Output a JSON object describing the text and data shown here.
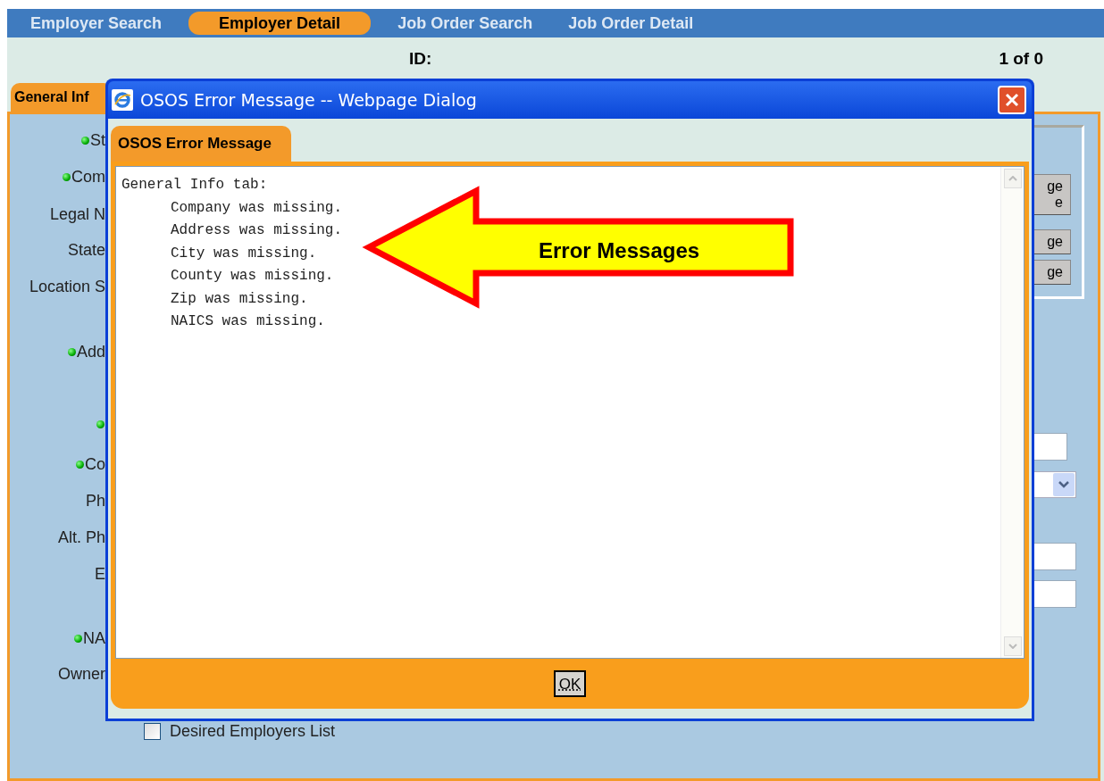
{
  "nav_tabs": [
    {
      "label": "Employer Search",
      "selected": false
    },
    {
      "label": "Employer Detail",
      "selected": true
    },
    {
      "label": "Job Order Search",
      "selected": false
    },
    {
      "label": "Job Order Detail",
      "selected": false
    }
  ],
  "header": {
    "id_label": "ID:",
    "record_count": "1 of 0"
  },
  "page_tab": {
    "label": "General Inf",
    "selected": true
  },
  "form_labels": [
    {
      "label": "St",
      "required": true
    },
    {
      "label": "Com",
      "required": true
    },
    {
      "label": "Legal N",
      "required": false
    },
    {
      "label": "State",
      "required": false
    },
    {
      "label": "Location S",
      "required": false
    },
    {
      "label": "Add",
      "required": true
    },
    {
      "required": true
    },
    {
      "label": "Co",
      "required": true
    },
    {
      "label": "Ph",
      "required": false
    },
    {
      "label": "Alt. Ph",
      "required": false
    },
    {
      "label": "E",
      "required": false
    },
    {
      "label": "NA",
      "required": true
    },
    {
      "label": "Owner",
      "required": false
    }
  ],
  "right_buttons": [
    {
      "lines": [
        "ge",
        "e"
      ]
    },
    {
      "lines": [
        "ge"
      ]
    },
    {
      "lines": [
        "ge"
      ]
    }
  ],
  "right_fields": [
    {
      "kind": "input"
    },
    {
      "kind": "select"
    },
    {
      "kind": "input"
    },
    {
      "kind": "input"
    }
  ],
  "checkbox": {
    "label": "Desired Employers List",
    "checked": false
  },
  "dialog": {
    "title": "OSOS Error Message -- Webpage Dialog",
    "tab": "OSOS Error Message",
    "message_heading": "General Info tab:",
    "messages": [
      "Company was missing.",
      "Address was missing.",
      "City was missing.",
      "County was missing.",
      "Zip was missing.",
      "NAICS was missing."
    ],
    "ok_button": "OK"
  },
  "callout": {
    "label": "Error Messages"
  }
}
